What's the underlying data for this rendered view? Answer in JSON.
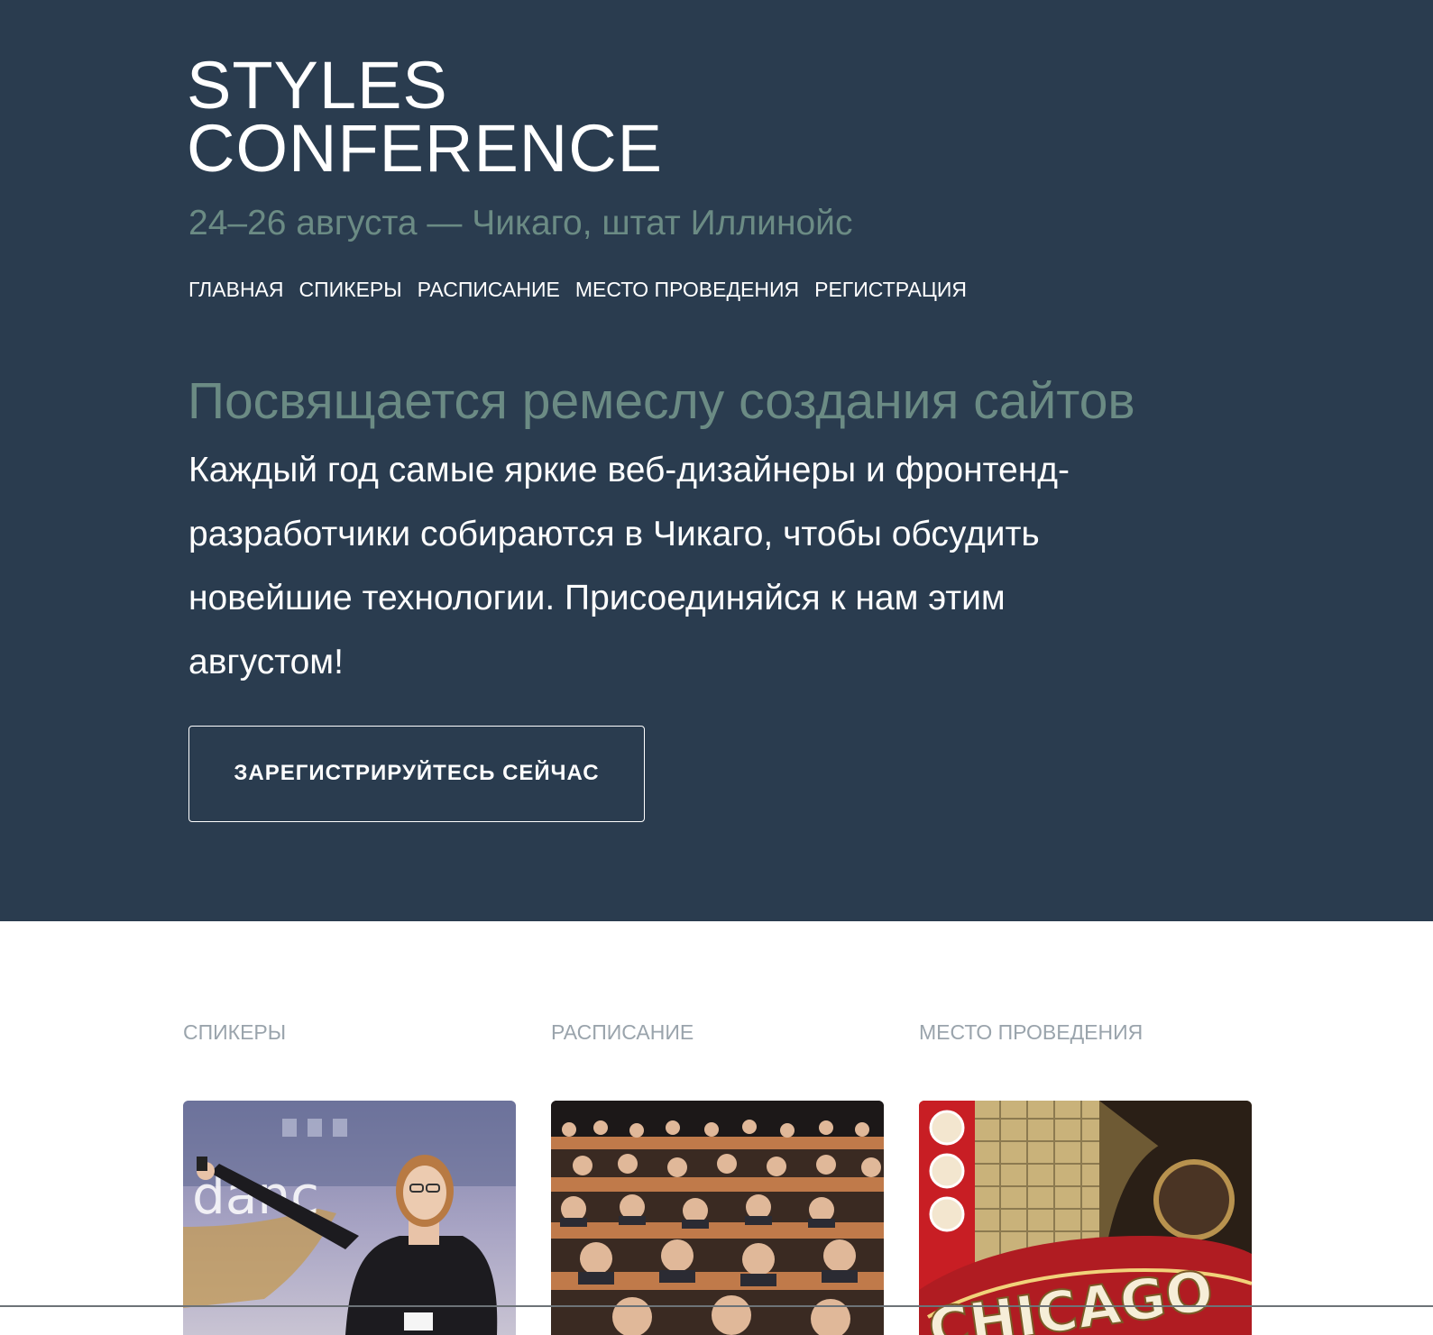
{
  "header": {
    "logo_line1": "STYLES",
    "logo_line2": "CONFERENCE",
    "tagline": "24–26 августа — Чикаго, штат Иллинойс"
  },
  "nav": {
    "items": [
      {
        "label": "ГЛАВНАЯ"
      },
      {
        "label": "СПИКЕРЫ"
      },
      {
        "label": "РАСПИСАНИЕ"
      },
      {
        "label": "МЕСТО ПРОВЕДЕНИЯ"
      },
      {
        "label": "РЕГИСТРАЦИЯ"
      }
    ]
  },
  "hero": {
    "heading": "Посвящается ремеслу создания сайтов",
    "text": "Каждый год самые яркие веб-дизайнеры и фронтенд-разработчики собираются в Чикаго, чтобы обсудить новейшие технологии. Присоединяйся к нам этим августом!",
    "cta_label": "ЗАРЕГИСТРИРУЙТЕСЬ СЕЙЧАС"
  },
  "features": [
    {
      "label": "СПИКЕРЫ",
      "image": "speaker-photo"
    },
    {
      "label": "РАСПИСАНИЕ",
      "image": "audience-photo"
    },
    {
      "label": "МЕСТО ПРОВЕДЕНИЯ",
      "image": "chicago-theatre-photo"
    }
  ],
  "colors": {
    "hero_bg": "#2a3c4f",
    "accent_muted": "#6b8b84",
    "feature_label": "#9aa4ac",
    "text_light": "#ffffff"
  }
}
